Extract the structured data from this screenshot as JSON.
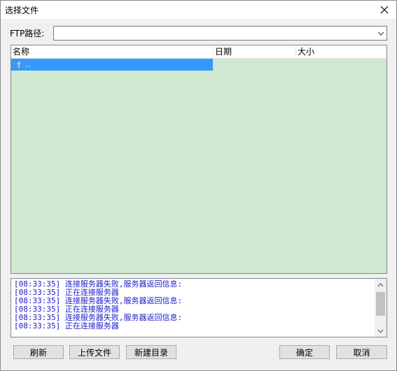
{
  "window": {
    "title": "选择文件"
  },
  "ftp": {
    "label": "FTP路径:",
    "value": "",
    "placeholder": ""
  },
  "filelist": {
    "columns": [
      "名称",
      "日期",
      "大小"
    ],
    "rows": [
      {
        "name": "..",
        "date": "",
        "size": "",
        "icon": "up-folder-icon",
        "selected": true
      }
    ],
    "background_color": "#cfe8cf",
    "selection_color": "#3399ff"
  },
  "log": {
    "lines": [
      "[08:33:35] 连接服务器失败,服务器返回信息:",
      "[08:33:35] 正在连接服务器",
      "[08:33:35] 连接服务器失败,服务器返回信息:",
      "[08:33:35] 正在连接服务器",
      "[08:33:35] 连接服务器失败,服务器返回信息:",
      "[08:33:35] 正在连接服务器"
    ],
    "text_color": "#1a1acc"
  },
  "buttons": {
    "refresh": "刷新",
    "upload": "上传文件",
    "new_dir": "新建目录",
    "ok": "确定",
    "cancel": "取消"
  }
}
